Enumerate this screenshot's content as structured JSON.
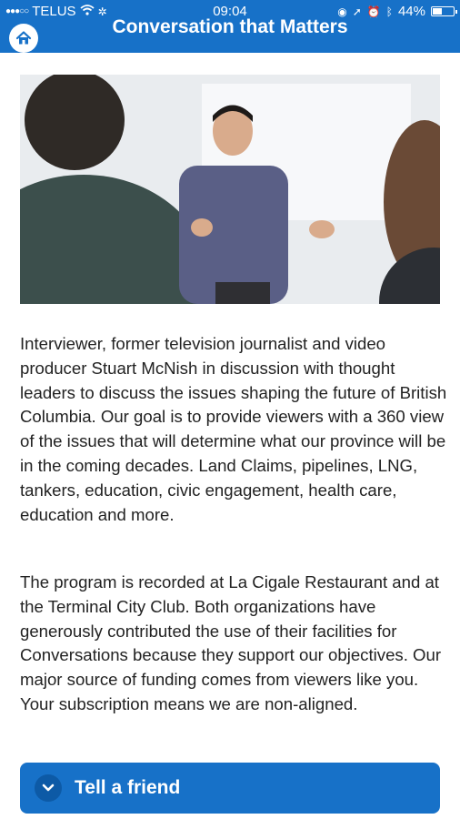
{
  "status_bar": {
    "carrier": "TELUS",
    "time": "09:04",
    "battery": "44%"
  },
  "header": {
    "title": "Conversation that Matters"
  },
  "main": {
    "paragraph_1": "Interviewer, former television journalist and video producer Stuart McNish in discussion with thought leaders to discuss the issues shaping the future of British Columbia. Our goal is to provide viewers with a 360 view of the issues that will determine what our province will be in the coming decades. Land Claims, pipelines, LNG, tankers, education, civic engagement, health care, education and more.",
    "paragraph_2": "The program is recorded at La Cigale Restaurant and at the Terminal City Club. Both organizations have generously contributed the use of their facilities for Conversations because they support our objectives. Our major source of funding comes from viewers like you. Your subscription means we are non-aligned."
  },
  "actions": {
    "tell_friend_label": "Tell a friend"
  },
  "colors": {
    "brand": "#1771c8"
  }
}
